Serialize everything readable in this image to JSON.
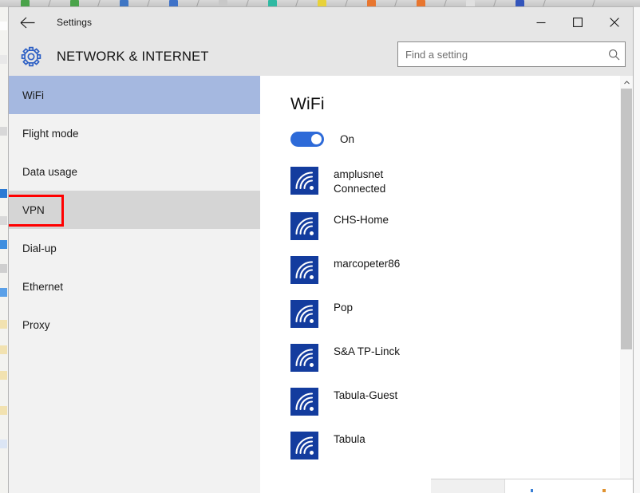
{
  "window": {
    "title": "Settings",
    "back_icon": "back-arrow-icon",
    "controls": {
      "minimize": "minimize-icon",
      "maximize": "maximize-icon",
      "close": "close-icon"
    }
  },
  "header": {
    "icon": "gear-icon",
    "title": "NETWORK & INTERNET"
  },
  "search": {
    "placeholder": "Find a setting",
    "value": "",
    "icon": "search-icon"
  },
  "sidebar": {
    "items": [
      {
        "label": "WiFi",
        "state": "selected"
      },
      {
        "label": "Flight mode",
        "state": "normal"
      },
      {
        "label": "Data usage",
        "state": "normal"
      },
      {
        "label": "VPN",
        "state": "hovered"
      },
      {
        "label": "Dial-up",
        "state": "normal"
      },
      {
        "label": "Ethernet",
        "state": "normal"
      },
      {
        "label": "Proxy",
        "state": "normal"
      }
    ],
    "annotation": {
      "target": "VPN",
      "color": "#ff0000"
    }
  },
  "content": {
    "heading": "WiFi",
    "toggle": {
      "label": "On",
      "state": "on",
      "color": "#2d6ad8"
    },
    "networks": [
      {
        "name": "amplusnet",
        "status": "Connected",
        "icon": "wifi-icon"
      },
      {
        "name": "CHS-Home",
        "status": "",
        "icon": "wifi-icon"
      },
      {
        "name": "marcopeter86",
        "status": "",
        "icon": "wifi-icon"
      },
      {
        "name": "Pop",
        "status": "",
        "icon": "wifi-icon"
      },
      {
        "name": "S&A TP-Linck",
        "status": "",
        "icon": "wifi-icon"
      },
      {
        "name": "Tabula-Guest",
        "status": "",
        "icon": "wifi-icon"
      },
      {
        "name": "Tabula",
        "status": "",
        "icon": "wifi-icon"
      }
    ]
  },
  "colors": {
    "selected_nav": "#a5b8e0",
    "hovered_nav": "#d5d5d5",
    "wifi_icon": "#133c9e",
    "chrome": "#e6e6e6",
    "sidebar": "#f2f2f2"
  },
  "background": {
    "taskbar_icons": [
      "#4aa34a",
      "#4aa34a",
      "#3f76c4",
      "#3f72c8",
      "#c8c8c8",
      "#2fb9a2",
      "#e8d23a",
      "#e8762f",
      "#e8762f",
      "#e0e0e0",
      "#3355bb"
    ]
  }
}
